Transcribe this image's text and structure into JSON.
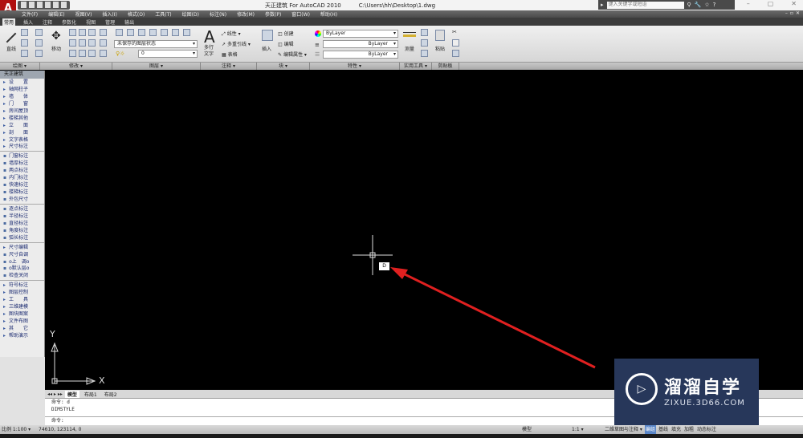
{
  "titlebar": {
    "app_title": "天正建筑 For AutoCAD 2010",
    "file_path": "C:\\Users\\hh\\Desktop\\1.dwg",
    "search_placeholder": "键入关键字或短语",
    "logo": "A"
  },
  "menu": [
    "文件(F)",
    "编辑(E)",
    "视图(V)",
    "插入(I)",
    "格式(O)",
    "工具(T)",
    "绘图(D)",
    "标注(N)",
    "修改(M)",
    "参数(P)",
    "窗口(W)",
    "帮助(H)"
  ],
  "ribbon_tabs": [
    "常用",
    "插入",
    "注释",
    "参数化",
    "视图",
    "管理",
    "输出"
  ],
  "ribbon": {
    "draw": {
      "line": "直线"
    },
    "modify": {
      "move": "移动"
    },
    "layers": {
      "state": "未保存的图层状态",
      "layer": "0"
    },
    "annotation": {
      "text": "多行文字",
      "dim": "线性",
      "leader": "多重引线",
      "table": "表格"
    },
    "block": {
      "insert": "插入",
      "create": "创建",
      "edit": "编辑",
      "edit_attr": "编辑属性"
    },
    "properties": {
      "color": "ByLayer",
      "linetype": "ByLayer",
      "lineweight": "ByLayer"
    },
    "utilities": {
      "measure": "测量"
    },
    "clipboard": {
      "paste": "粘贴"
    },
    "panel_labels": [
      "绘图 ▾",
      "修改 ▾",
      "图层 ▾",
      "注释 ▾",
      "块 ▾",
      "特性 ▾",
      "实用工具 ▾",
      "剪贴板"
    ]
  },
  "palette": {
    "title": "天正建筑",
    "items": [
      {
        "label": "设　　置",
        "type": "ar"
      },
      {
        "label": "轴网柱子",
        "type": "ar"
      },
      {
        "label": "墙　　体",
        "type": "ar"
      },
      {
        "label": "门　　窗",
        "type": "ar"
      },
      {
        "label": "房间屋顶",
        "type": "ar"
      },
      {
        "label": "楼梯其他",
        "type": "ar"
      },
      {
        "label": "立　　面",
        "type": "ar"
      },
      {
        "label": "剖　　面",
        "type": "ar"
      },
      {
        "label": "文字表格",
        "type": "ar"
      },
      {
        "label": "尺寸标注",
        "type": "ar"
      },
      {
        "label": "sep"
      },
      {
        "label": "门窗标注",
        "type": "ic"
      },
      {
        "label": "墙厚标注",
        "type": "ic"
      },
      {
        "label": "两点标注",
        "type": "ic"
      },
      {
        "label": "内门标注",
        "type": "ic"
      },
      {
        "label": "快速标注",
        "type": "ic"
      },
      {
        "label": "楼梯标注",
        "type": "ic"
      },
      {
        "label": "外包尺寸",
        "type": "ic"
      },
      {
        "label": "sep"
      },
      {
        "label": "逐点标注",
        "type": "ic"
      },
      {
        "label": "半径标注",
        "type": "ic"
      },
      {
        "label": "直径标注",
        "type": "ic"
      },
      {
        "label": "角度标注",
        "type": "ic"
      },
      {
        "label": "弧长标注",
        "type": "ic"
      },
      {
        "label": "sep"
      },
      {
        "label": "尺寸编辑",
        "type": "ar"
      },
      {
        "label": "尺寸自调",
        "type": "ic"
      },
      {
        "label": "o上　调o",
        "type": "ic"
      },
      {
        "label": "o默认层o",
        "type": "ic"
      },
      {
        "label": "检查关闭",
        "type": "ic"
      },
      {
        "label": "sep"
      },
      {
        "label": "符号标注",
        "type": "ar"
      },
      {
        "label": "图层控制",
        "type": "ar"
      },
      {
        "label": "工　　具",
        "type": "ar"
      },
      {
        "label": "三维建模",
        "type": "ar"
      },
      {
        "label": "图块图案",
        "type": "ar"
      },
      {
        "label": "文件布图",
        "type": "ar"
      },
      {
        "label": "其　　它",
        "type": "ar"
      },
      {
        "label": "帮助演示",
        "type": "ar"
      }
    ]
  },
  "canvas": {
    "ucs_x": "X",
    "ucs_y": "Y",
    "cursor_input": "D"
  },
  "layout_tabs": [
    "模型",
    "布局1",
    "布局2"
  ],
  "command": {
    "lines": [
      "命令: d",
      "DIMSTYLE"
    ],
    "prompt": "命令:"
  },
  "status": {
    "scale": "比例 1:100 ▾",
    "coords": "74610, 123114, 0",
    "right": [
      "模型",
      "二维草图与注释 ▾",
      "编组",
      "基线",
      "填充",
      "加粗",
      "动态标注"
    ],
    "annotation_scale": "1:1 ▾"
  },
  "watermark": {
    "title": "溜溜自学",
    "url": "ZIXUE.3D66.COM"
  },
  "colors": {
    "canvas": "#000000",
    "arrow": "#e02020",
    "watermark_bg": "#27375a"
  }
}
